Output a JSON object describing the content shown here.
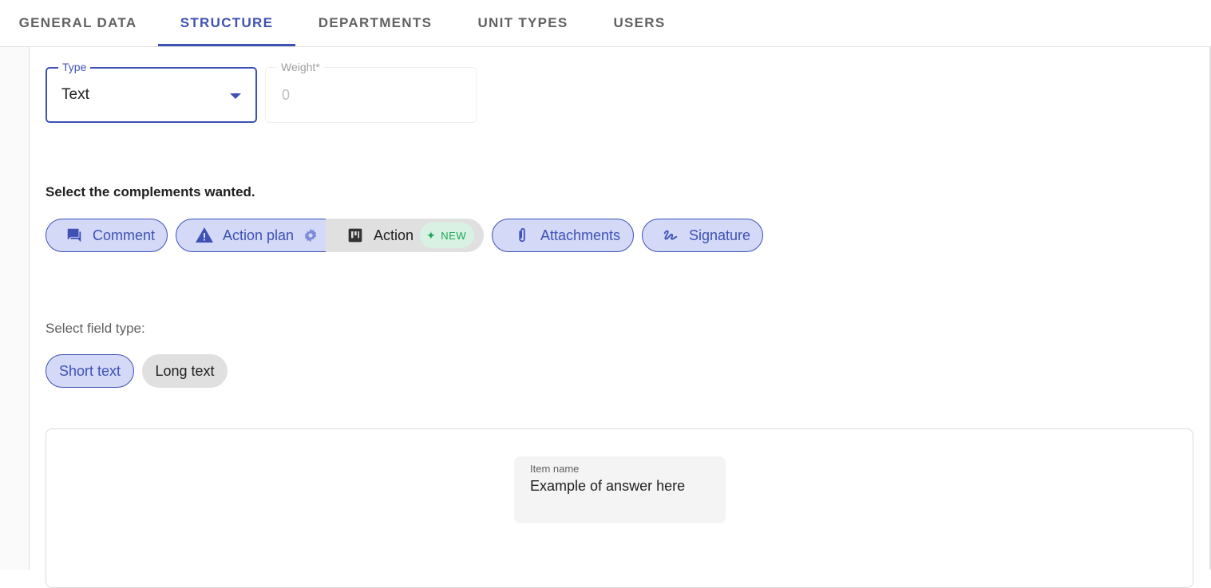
{
  "tabs": [
    {
      "label": "GENERAL DATA",
      "active": false
    },
    {
      "label": "STRUCTURE",
      "active": true
    },
    {
      "label": "DEPARTMENTS",
      "active": false
    },
    {
      "label": "UNIT TYPES",
      "active": false
    },
    {
      "label": "USERS",
      "active": false
    }
  ],
  "type_field": {
    "label": "Type",
    "value": "Text"
  },
  "weight_field": {
    "label": "Weight*",
    "value": "0"
  },
  "complements": {
    "title": "Select the complements wanted.",
    "chips": [
      {
        "label": "Comment",
        "icon": "comment-icon",
        "selected": true
      },
      {
        "label": "Action plan",
        "icon": "warning-icon",
        "selected": true
      },
      {
        "label": "Action",
        "icon": "board-icon",
        "selected": false,
        "badge": "NEW"
      },
      {
        "label": "Attachments",
        "icon": "paperclip-icon",
        "selected": true
      },
      {
        "label": "Signature",
        "icon": "signature-icon",
        "selected": true
      }
    ]
  },
  "field_type": {
    "title": "Select field type:",
    "options": [
      {
        "label": "Short text",
        "selected": true
      },
      {
        "label": "Long text",
        "selected": false
      }
    ]
  },
  "preview": {
    "label": "Item name",
    "value": "Example of answer here"
  },
  "colors": {
    "accent": "#3f51b5",
    "chip_bg": "#d3d9f7",
    "badge_bg": "#d8f1e2",
    "badge_text": "#1ea75a"
  }
}
